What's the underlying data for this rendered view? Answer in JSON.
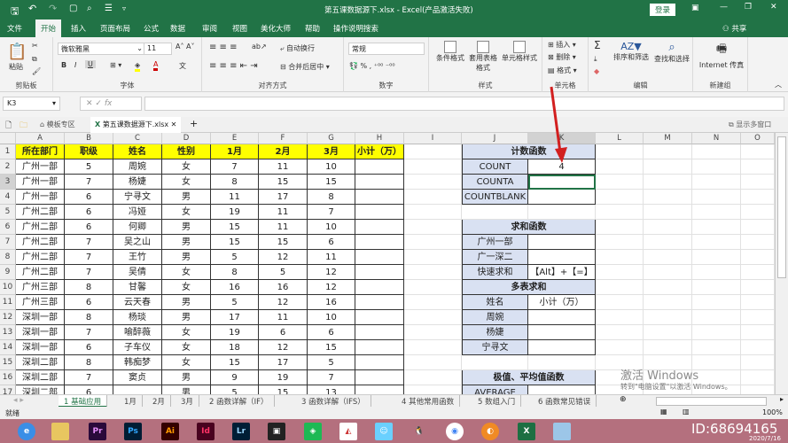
{
  "window": {
    "filename": "第五课数据源下.xlsx",
    "app": "Excel(产品激活失败)",
    "login": "登录",
    "share": "共享"
  },
  "menu": [
    "文件",
    "开始",
    "插入",
    "页面布局",
    "公式",
    "数据",
    "审阅",
    "视图",
    "美化大师",
    "帮助",
    "操作说明搜索"
  ],
  "ribbon": {
    "paste": "粘贴",
    "clipboard": "剪贴板",
    "font_name": "微软雅黑",
    "font_size": "11",
    "font": "字体",
    "wrap": "自动换行",
    "merge": "合并后居中",
    "align": "对齐方式",
    "num_format": "常规",
    "number": "数字",
    "cond_format": "条件格式",
    "table_format": "套用表格格式",
    "cell_style": "单元格样式",
    "styles": "样式",
    "insert": "插入",
    "delete": "删除",
    "format": "格式",
    "cells": "单元格",
    "sort": "排序和筛选",
    "find": "查找和选择",
    "editing": "编辑",
    "fax": "Internet 传真",
    "newgroup": "新建组"
  },
  "formula": {
    "namebox": "K3",
    "fx": "fx",
    "value": ""
  },
  "workbook_tabs": {
    "template": "模板专区",
    "file": "第五课数据源下.xlsx",
    "multi": "显示多窗口"
  },
  "columns": [
    "A",
    "B",
    "C",
    "D",
    "E",
    "F",
    "G",
    "H",
    "I",
    "J",
    "K",
    "L",
    "M",
    "N",
    "O"
  ],
  "headers": [
    "所在部门",
    "职级",
    "姓名",
    "性别",
    "1月",
    "2月",
    "3月",
    "小计（万）"
  ],
  "rows": [
    [
      "广州一部",
      "5",
      "周婉",
      "女",
      "7",
      "11",
      "10"
    ],
    [
      "广州一部",
      "7",
      "杨婕",
      "女",
      "8",
      "15",
      "15"
    ],
    [
      "广州一部",
      "6",
      "宁寻文",
      "男",
      "11",
      "17",
      "8"
    ],
    [
      "广州二部",
      "6",
      "冯娅",
      "女",
      "19",
      "11",
      "7"
    ],
    [
      "广州二部",
      "6",
      "何卿",
      "男",
      "15",
      "11",
      "10"
    ],
    [
      "广州二部",
      "7",
      "吴之山",
      "男",
      "15",
      "15",
      "6"
    ],
    [
      "广州二部",
      "7",
      "王竹",
      "男",
      "5",
      "12",
      "11"
    ],
    [
      "广州二部",
      "7",
      "吴倩",
      "女",
      "8",
      "5",
      "12"
    ],
    [
      "广州三部",
      "8",
      "甘馨",
      "女",
      "16",
      "16",
      "12"
    ],
    [
      "广州三部",
      "6",
      "云天春",
      "男",
      "5",
      "12",
      "16"
    ],
    [
      "深圳一部",
      "8",
      "杨琰",
      "男",
      "17",
      "11",
      "10"
    ],
    [
      "深圳一部",
      "7",
      "喻醉薇",
      "女",
      "19",
      "6",
      "6"
    ],
    [
      "深圳一部",
      "6",
      "子车仪",
      "女",
      "18",
      "12",
      "15"
    ],
    [
      "深圳二部",
      "8",
      "韩痴梦",
      "女",
      "15",
      "17",
      "5"
    ],
    [
      "深圳二部",
      "7",
      "窦贞",
      "男",
      "9",
      "19",
      "7"
    ],
    [
      "深圳二部",
      "6",
      "",
      "男",
      "5",
      "15",
      "13"
    ]
  ],
  "side": [
    {
      "merged": "计数函数"
    },
    {
      "label": "COUNT",
      "value": "4"
    },
    {
      "label": "COUNTA",
      "value": ""
    },
    {
      "label": "COUNTBLANK",
      "value": ""
    },
    null,
    {
      "merged": "求和函数"
    },
    {
      "label": "广州一部",
      "value": ""
    },
    {
      "label": "广一深二",
      "value": ""
    },
    {
      "label": "快速求和",
      "value": "【Alt】+【=】"
    },
    {
      "merged": "多表求和"
    },
    {
      "label": "姓名",
      "value": "小计（万）"
    },
    {
      "label": "周婉",
      "value": ""
    },
    {
      "label": "杨婕",
      "value": ""
    },
    {
      "label": "宁寻文",
      "value": ""
    },
    null,
    {
      "merged": "极值、平均值函数"
    },
    {
      "label": "AVERAGE",
      "value": ""
    }
  ],
  "sheets": [
    "1 基础应用",
    "1月",
    "2月",
    "3月",
    "2 函数详解（IF）",
    "3 函数详解（IFS）",
    "4 其他常用函数",
    "5 数组入门",
    "6 函数常见错误"
  ],
  "status": {
    "ready": "就绪",
    "zoom": "100%"
  },
  "watermark": {
    "line1": "激活 Windows",
    "line2": "转到\"电脑设置\"以激活 Windows。",
    "id": "ID:68694165",
    "date": "2020/7/16"
  },
  "colors": {
    "excel_green": "#217346",
    "header_yellow": "#ffff00",
    "table_blue": "#d9e1f2",
    "arrow": "#d21f1f"
  }
}
